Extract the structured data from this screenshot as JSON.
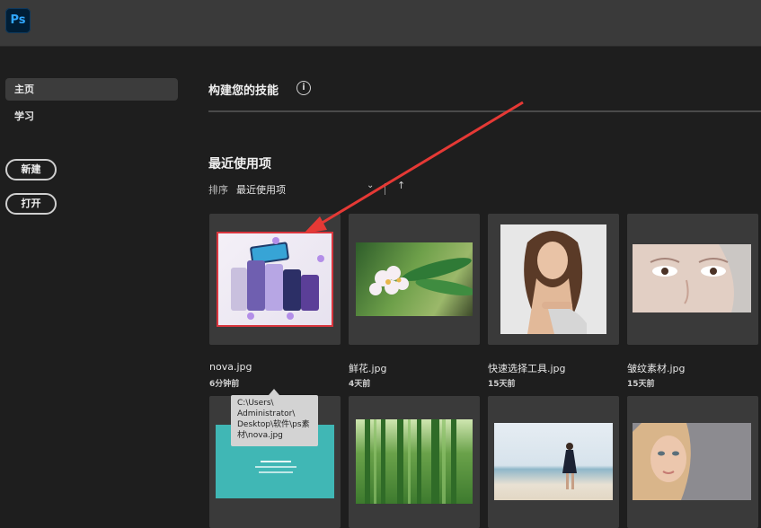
{
  "app": {
    "logo_text": "Ps"
  },
  "sidebar": {
    "items": [
      {
        "label": "主页",
        "active": true
      },
      {
        "label": "学习",
        "active": false
      }
    ],
    "new_label": "新建",
    "open_label": "打开"
  },
  "skills": {
    "title": "构建您的技能",
    "info_icon": "info-icon"
  },
  "recent": {
    "title": "最近使用项",
    "sort_label": "排序",
    "sort_value": "最近使用项",
    "sort_chevron": "⌄",
    "sort_direction": "↑",
    "files": [
      {
        "name": "nova.jpg",
        "time": "6分钟前"
      },
      {
        "name": "鲜花.jpg",
        "time": "4天前"
      },
      {
        "name": "快速选择工具.jpg",
        "time": "15天前"
      },
      {
        "name": "皱纹素材.jpg",
        "time": "15天前"
      },
      {
        "name": "",
        "time": ""
      },
      {
        "name": "",
        "time": ""
      },
      {
        "name": "",
        "time": ""
      },
      {
        "name": "",
        "time": ""
      }
    ]
  },
  "tooltip": {
    "path": "C:\\Users\\ Administrator\\ Desktop\\软件\\ps素材\\nova.jpg"
  },
  "colors": {
    "annotation_arrow": "#e53935",
    "selection_border": "#d9363e"
  }
}
